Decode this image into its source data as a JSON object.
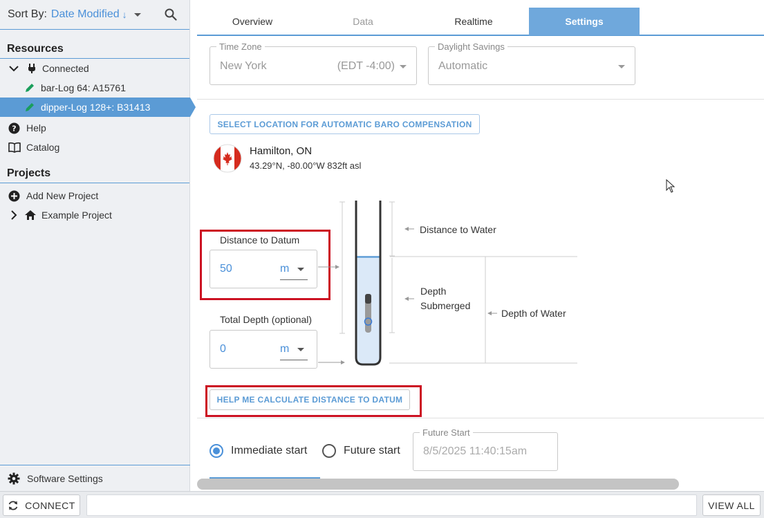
{
  "sidebar": {
    "sort_label": "Sort By:",
    "sort_value": "Date Modified",
    "sort_dir_icon": "↓",
    "resources_heading": "Resources",
    "connected_label": "Connected",
    "devices": [
      {
        "label": "bar-Log 64: A15761",
        "selected": false
      },
      {
        "label": "dipper-Log 128+: B31413",
        "selected": true
      }
    ],
    "help_label": "Help",
    "catalog_label": "Catalog",
    "projects_heading": "Projects",
    "add_project_label": "Add New Project",
    "example_project_label": "Example Project",
    "software_settings_label": "Software Settings"
  },
  "tabs": [
    {
      "label": "Overview",
      "state": "normal"
    },
    {
      "label": "Data",
      "state": "muted"
    },
    {
      "label": "Realtime",
      "state": "normal"
    },
    {
      "label": "Settings",
      "state": "active"
    }
  ],
  "timezone": {
    "legend": "Time Zone",
    "value": "New York",
    "offset": "(EDT -4:00)"
  },
  "daylight": {
    "legend": "Daylight Savings",
    "value": "Automatic"
  },
  "baro_button": "SELECT LOCATION FOR AUTOMATIC BARO COMPENSATION",
  "location": {
    "name": "Hamilton, ON",
    "coords": "43.29°N, -80.00°W 832ft asl"
  },
  "distance_to_datum": {
    "label": "Distance to Datum",
    "value": "50",
    "unit": "m"
  },
  "total_depth": {
    "label": "Total Depth (optional)",
    "value": "0",
    "unit": "m"
  },
  "diagram": {
    "distance_to_water": "Distance to Water",
    "depth_submerged_1": "Depth",
    "depth_submerged_2": "Submerged",
    "depth_of_water": "Depth of Water"
  },
  "calc_button": "HELP ME CALCULATE DISTANCE TO DATUM",
  "start": {
    "immediate_label": "Immediate start",
    "future_label": "Future start",
    "future_legend": "Future Start",
    "future_value": "8/5/2025 11:40:15am",
    "selected": "immediate"
  },
  "bottombar": {
    "connect_label": "CONNECT",
    "view_all_label": "VIEW ALL"
  },
  "colors": {
    "accent": "#5b9bd5",
    "highlight_red": "#cc1122",
    "green_pencil": "#1a9e5c"
  }
}
